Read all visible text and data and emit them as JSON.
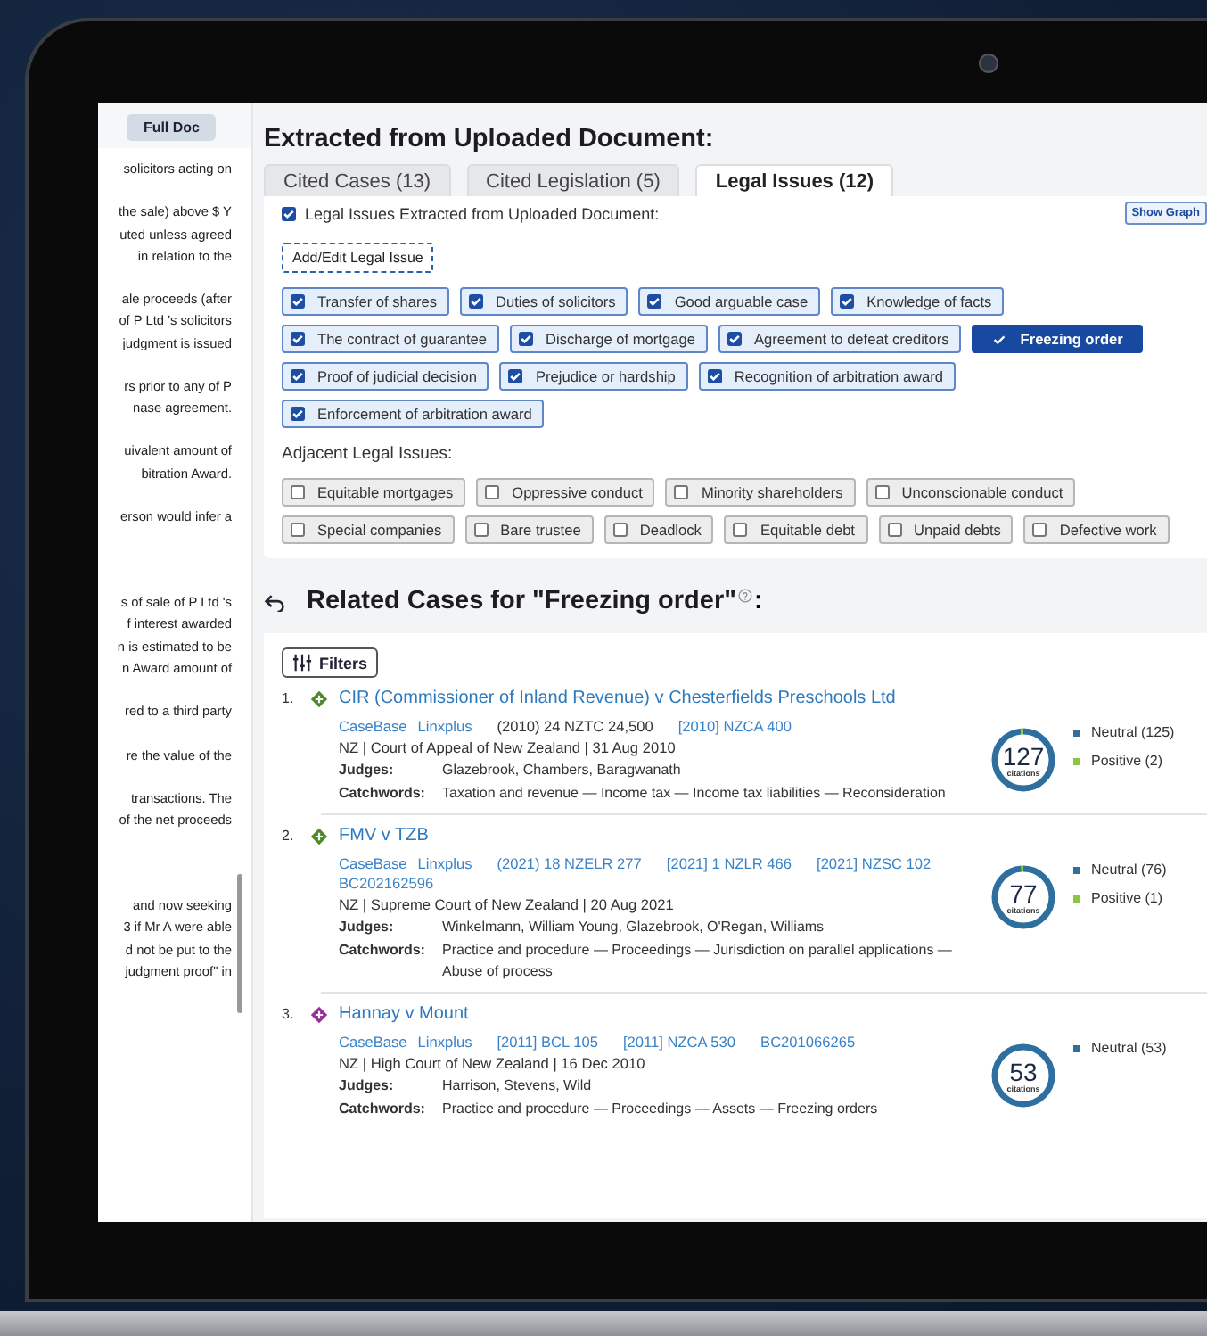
{
  "document_panel": {
    "button": "Full Doc",
    "paragraphs": [
      [
        "solicitors acting on"
      ],
      [
        "the sale) above $ Y",
        "uted unless agreed",
        "in relation to the"
      ],
      [
        "ale proceeds (after",
        "of P Ltd 's solicitors",
        "judgment is issued"
      ],
      [
        "rs prior to any of P",
        "nase agreement."
      ],
      [
        "uivalent amount of",
        "bitration Award."
      ],
      [
        "erson would infer a"
      ],
      [
        "s of sale of P Ltd 's",
        "f interest awarded",
        "n is estimated to be",
        "n Award amount of"
      ],
      [
        "red to a third party"
      ],
      [
        "re the value of the"
      ],
      [
        "transactions.   The",
        "of the net proceeds"
      ],
      [
        "and now seeking",
        "3 if Mr A were able",
        "d not be put to the",
        "judgment proof\" in"
      ]
    ]
  },
  "heading": "Extracted from Uploaded Document:",
  "tabs": [
    {
      "label": "Cited Cases (13)",
      "selected": false
    },
    {
      "label": "Cited Legislation (5)",
      "selected": false
    },
    {
      "label": "Legal Issues (12)",
      "selected": true
    }
  ],
  "legal_issues": {
    "header": {
      "label": "Legal Issues Extracted from Uploaded Document:",
      "checked": true
    },
    "show_graph": "Show Graph",
    "add_edit": "Add/Edit Legal Issue",
    "issues": [
      {
        "label": "Transfer of shares",
        "checked": true,
        "selected": false
      },
      {
        "label": "Duties of solicitors",
        "checked": true,
        "selected": false
      },
      {
        "label": "Good arguable case",
        "checked": true,
        "selected": false
      },
      {
        "label": "Knowledge of facts",
        "checked": true,
        "selected": false
      },
      {
        "label": "The contract of guarantee",
        "checked": true,
        "selected": false
      },
      {
        "label": "Discharge of mortgage",
        "checked": true,
        "selected": false
      },
      {
        "label": "Agreement to defeat creditors",
        "checked": true,
        "selected": false
      },
      {
        "label": "Freezing order",
        "checked": true,
        "selected": true
      },
      {
        "label": "Proof of judicial decision",
        "checked": true,
        "selected": false
      },
      {
        "label": "Prejudice or hardship",
        "checked": true,
        "selected": false
      },
      {
        "label": "Recognition of arbitration award",
        "checked": true,
        "selected": false
      },
      {
        "label": "Enforcement of arbitration award",
        "checked": true,
        "selected": false
      }
    ],
    "adjacent_heading": "Adjacent Legal Issues:",
    "adjacent": [
      {
        "label": "Equitable mortgages",
        "checked": false
      },
      {
        "label": "Oppressive conduct",
        "checked": false
      },
      {
        "label": "Minority shareholders",
        "checked": false
      },
      {
        "label": "Unconscionable conduct",
        "checked": false
      },
      {
        "label": "Special companies",
        "checked": false
      },
      {
        "label": "Bare trustee",
        "checked": false
      },
      {
        "label": "Deadlock",
        "checked": false
      },
      {
        "label": "Equitable debt",
        "checked": false
      },
      {
        "label": "Unpaid debts",
        "checked": false
      },
      {
        "label": "Defective work",
        "checked": false
      }
    ]
  },
  "related": {
    "title": "Related Cases for \"Freezing order\"",
    "title_end": ":",
    "filters": "Filters",
    "cases": [
      {
        "number": "1.",
        "color": "#4e8a2a",
        "title": "CIR (Commissioner of Inland Revenue) v Chesterfields Preschools Ltd",
        "citations": [
          {
            "text": "CaseBase",
            "kind": "link"
          },
          {
            "text": "Linxplus",
            "kind": "link"
          },
          {
            "text": "(2010) 24 NZTC 24,500",
            "kind": "plain"
          },
          {
            "text": "[2010] NZCA 400",
            "kind": "link"
          }
        ],
        "court": "NZ | Court of Appeal of New Zealand | 31 Aug 2010",
        "judges_label": "Judges:",
        "judges": "Glazebrook, Chambers, Baragwanath",
        "catchwords_label": "Catchwords:",
        "catchwords": "Taxation and revenue — Income tax — Income tax liabilities — Reconsideration",
        "count": "127",
        "count_label": "citations",
        "treatments": [
          {
            "label": "Neutral (125)",
            "color": "#2f6f9f",
            "level": 0.984
          },
          {
            "label": "Positive (2)",
            "color": "#8cc63f",
            "level": 0.016
          }
        ]
      },
      {
        "number": "2.",
        "color": "#4e8a2a",
        "title": "FMV v TZB",
        "citations": [
          {
            "text": "CaseBase",
            "kind": "link"
          },
          {
            "text": "Linxplus",
            "kind": "link"
          },
          {
            "text": "(2021) 18 NZELR 277",
            "kind": "link"
          },
          {
            "text": "[2021] 1 NZLR 466",
            "kind": "link"
          },
          {
            "text": "[2021] NZSC 102",
            "kind": "link"
          },
          {
            "text": "BC202162596",
            "kind": "link"
          }
        ],
        "court": "NZ | Supreme Court of New Zealand | 20 Aug 2021",
        "judges_label": "Judges:",
        "judges": "Winkelmann, William Young, Glazebrook, O'Regan, Williams",
        "catchwords_label": "Catchwords:",
        "catchwords": "Practice and procedure — Proceedings — Jurisdiction on parallel applications — Abuse of process",
        "count": "77",
        "count_label": "citations",
        "treatments": [
          {
            "label": "Neutral (76)",
            "color": "#2f6f9f",
            "level": 0.987
          },
          {
            "label": "Positive (1)",
            "color": "#8cc63f",
            "level": 0.013
          }
        ]
      },
      {
        "number": "3.",
        "color": "#9b2d9b",
        "title": "Hannay v Mount",
        "citations": [
          {
            "text": "CaseBase",
            "kind": "link"
          },
          {
            "text": "Linxplus",
            "kind": "link"
          },
          {
            "text": "[2011] BCL 105",
            "kind": "link"
          },
          {
            "text": "[2011] NZCA 530",
            "kind": "link"
          },
          {
            "text": "BC201066265",
            "kind": "link"
          }
        ],
        "court": "NZ | High Court of New Zealand | 16 Dec 2010",
        "judges_label": "Judges:",
        "judges": "Harrison, Stevens, Wild",
        "catchwords_label": "Catchwords:",
        "catchwords": "Practice and procedure — Proceedings — Assets — Freezing orders",
        "count": "53",
        "count_label": "citations",
        "treatments": [
          {
            "label": "Neutral (53)",
            "color": "#2f6f9f",
            "level": 1
          }
        ]
      }
    ]
  }
}
